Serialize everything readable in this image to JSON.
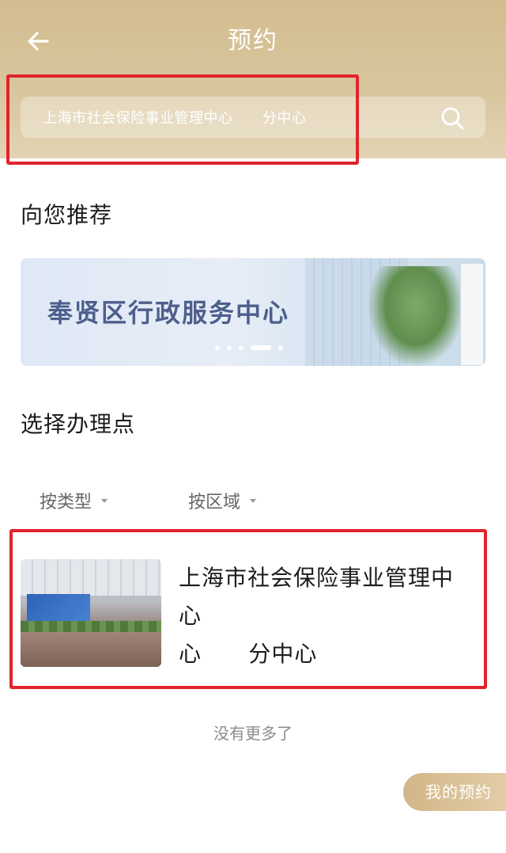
{
  "header": {
    "title": "预约",
    "back_icon": "arrow-left-icon"
  },
  "search": {
    "text": "上海市社会保险事业管理中心      分中心",
    "icon": "search-icon"
  },
  "recommend": {
    "heading": "向您推荐",
    "banner_text": "奉贤区行政服务中心",
    "carousel": {
      "count": 5,
      "active_index": 3
    }
  },
  "select_point": {
    "heading": "选择办理点",
    "filters": [
      {
        "label": "按类型"
      },
      {
        "label": "按区域"
      }
    ]
  },
  "list": {
    "items": [
      {
        "name": "上海市社会保险事业管理中心\n心      分中心"
      }
    ],
    "end_text": "没有更多了"
  },
  "float_button": {
    "label": "我的预约"
  },
  "colors": {
    "header_gold": "#d2bd8f",
    "highlight_red": "#e0242b",
    "button_gold": "#d2b688"
  }
}
